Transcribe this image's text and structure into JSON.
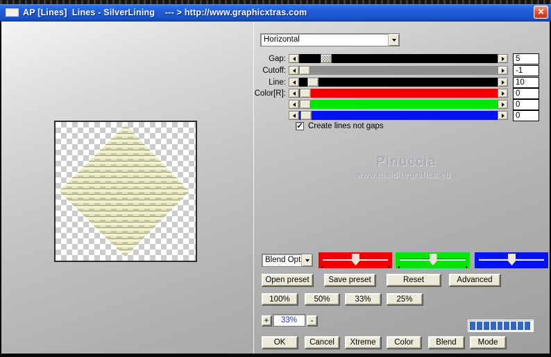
{
  "titlebar": {
    "title": "AP [Lines]  Lines - SilverLining    --- > http://www.graphicxtras.com",
    "close_glyph": "✕"
  },
  "colors": {
    "titlebar_blue": "#1f5bd7",
    "close_red": "#d4401f",
    "progress_blue": "#3166c4",
    "red_channel": "#f20000",
    "green_channel": "#00e400",
    "blue_channel": "#0014f0"
  },
  "mode_select": {
    "value": "Horizontal"
  },
  "sliders": [
    {
      "label": "Gap:",
      "value": "5",
      "track_color": "#000000"
    },
    {
      "label": "Cutoff:",
      "value": "-1",
      "track_color": "#8f8f8f"
    },
    {
      "label": "Line:",
      "value": "10",
      "track_color": "#000000"
    },
    {
      "label": "Color[R]:",
      "value": "0",
      "track_color": "#f20000"
    },
    {
      "label": "",
      "value": "0",
      "track_color": "#00e400"
    },
    {
      "label": "",
      "value": "0",
      "track_color": "#0014f0"
    }
  ],
  "checkbox": {
    "label": "Create lines not gaps",
    "checked": true,
    "check_glyph": "✓"
  },
  "watermark": {
    "name": "Pinuccia",
    "site": "www.maidiregrafica.eu"
  },
  "blend": {
    "select_value": "Blend Opti",
    "channels": [
      {
        "name": "red",
        "color": "#f20000"
      },
      {
        "name": "green",
        "color": "#00e400"
      },
      {
        "name": "blue",
        "color": "#0014f0"
      }
    ]
  },
  "preset_buttons": {
    "open": "Open preset",
    "save": "Save preset",
    "reset": "Reset",
    "advanced": "Advanced"
  },
  "zoom_buttons": {
    "b100": "100%",
    "b50": "50%",
    "b33": "33%",
    "b25": "25%"
  },
  "zoom_control": {
    "plus": "+",
    "value": "33%",
    "minus": "-"
  },
  "progress": {
    "segments": 9,
    "color": "#3166c4"
  },
  "actions": {
    "ok": "OK",
    "cancel": "Cancel",
    "xtreme": "Xtreme",
    "color": "Color",
    "blend": "Blend",
    "mode": "Mode"
  }
}
